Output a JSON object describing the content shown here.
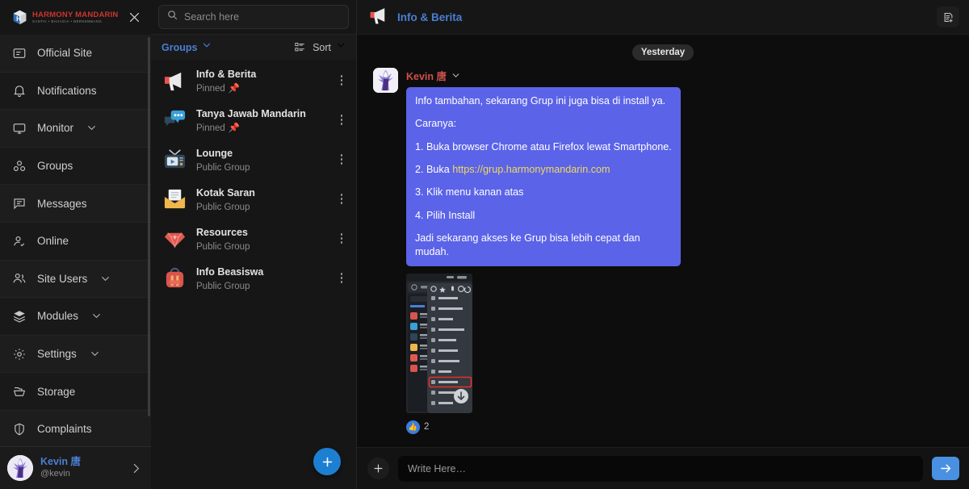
{
  "brand": {
    "title": "HARMONY MANDARIN",
    "subtitle": "SANTAI • BAHAGIA • BERKEMBANG",
    "close_label": "close-icon"
  },
  "sidebar": {
    "items": [
      {
        "label": "Official Site",
        "icon": "article-icon",
        "chevron": false
      },
      {
        "label": "Notifications",
        "icon": "bell-icon",
        "chevron": false
      },
      {
        "label": "Monitor",
        "icon": "monitor-icon",
        "chevron": true
      },
      {
        "label": "Groups",
        "icon": "groups-icon",
        "chevron": false
      },
      {
        "label": "Messages",
        "icon": "message-icon",
        "chevron": false
      },
      {
        "label": "Online",
        "icon": "user-check-icon",
        "chevron": false
      },
      {
        "label": "Site Users",
        "icon": "users-icon",
        "chevron": true
      },
      {
        "label": "Modules",
        "icon": "layers-icon",
        "chevron": true
      },
      {
        "label": "Settings",
        "icon": "gear-icon",
        "chevron": true
      },
      {
        "label": "Storage",
        "icon": "folder-icon",
        "chevron": false
      },
      {
        "label": "Complaints",
        "icon": "shield-icon",
        "chevron": false
      }
    ],
    "profile": {
      "name": "Kevin 唐",
      "handle": "@kevin",
      "arrow": "chevron-right-icon"
    }
  },
  "panel": {
    "search_placeholder": "Search here",
    "filter_label": "Groups",
    "sort_label": "Sort",
    "groups": [
      {
        "name": "Info & Berita",
        "sub": "Pinned",
        "pinned": true,
        "icon": "megaphone-icon"
      },
      {
        "name": "Tanya Jawab Mandarin",
        "sub": "Pinned",
        "pinned": true,
        "icon": "speech-bubbles-icon"
      },
      {
        "name": "Lounge",
        "sub": "Public Group",
        "pinned": false,
        "icon": "television-icon"
      },
      {
        "name": "Kotak Saran",
        "sub": "Public Group",
        "pinned": false,
        "icon": "envelope-icon"
      },
      {
        "name": "Resources",
        "sub": "Public Group",
        "pinned": false,
        "icon": "gem-icon"
      },
      {
        "name": "Info Beasiswa",
        "sub": "Public Group",
        "pinned": false,
        "icon": "backpack-icon"
      }
    ],
    "add_group_label": "+"
  },
  "chat": {
    "title": "Info & Berita",
    "title_icon": "megaphone-icon",
    "note_icon": "note-add-icon",
    "date_divider": "Yesterday",
    "message": {
      "sender": "Kevin 唐",
      "lines": [
        "Info tambahan, sekarang Grup ini juga bisa di install ya.",
        "Caranya:",
        "1. Buka browser Chrome atau Firefox lewat Smartphone.",
        "3. Klik menu kanan atas",
        "4. Pilih Install",
        "Jadi sekarang akses ke Grup bisa lebih cepat dan mudah."
      ],
      "link_line_prefix": "2. Buka ",
      "link_text": "https://grup.harmonymandarin.com",
      "attachment_alt": "phone-screenshot-install-app",
      "reaction_emoji": "👍",
      "reaction_count": "2"
    },
    "composer": {
      "add_label": "+",
      "placeholder": "Write Here…",
      "send_label": "send-icon"
    }
  },
  "colors": {
    "accent_blue": "#4a7fd4",
    "bubble": "#5b63e8",
    "link_yellow": "#f0d95c",
    "sender_red": "#d0504a",
    "send_button": "#4a90e2",
    "fab": "#1d7fd1"
  }
}
